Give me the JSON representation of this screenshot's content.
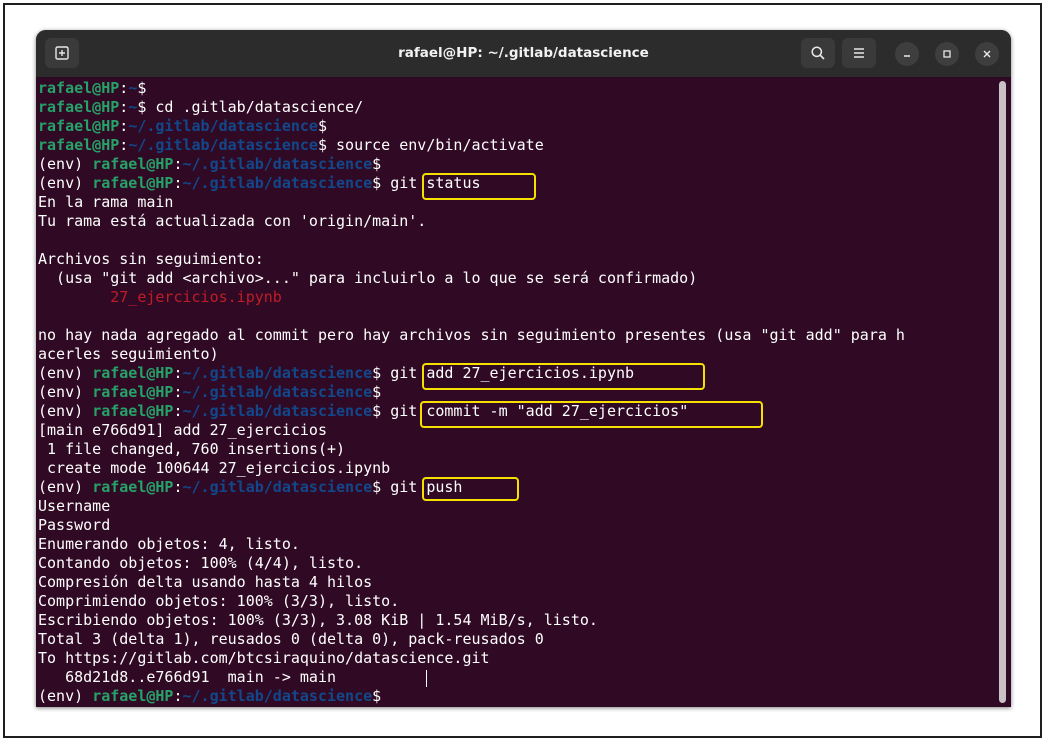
{
  "window": {
    "title": "rafael@HP: ~/.gitlab/datascience"
  },
  "prompt": {
    "user_host": "rafael@HP",
    "sep": ":",
    "env": "(env) ",
    "home": "~",
    "dir": "~/.gitlab/datascience",
    "dollar": "$"
  },
  "commands": {
    "cd": " cd .gitlab/datascience/",
    "source": " source env/bin/activate",
    "status": "git status",
    "add": "git add 27_ejercicios.ipynb",
    "commit": "git commit -m \"add 27_ejercicios\"",
    "push": "git push"
  },
  "output": {
    "status_branch": "En la rama main",
    "status_uptodate": "Tu rama está actualizada con 'origin/main'.",
    "untracked_header": "Archivos sin seguimiento:",
    "untracked_hint": "  (usa \"git add <archivo>...\" para incluirlo a lo que se será confirmado)",
    "untracked_file": "        27_ejercicios.ipynb",
    "nothing_added_1": "no hay nada agregado al commit pero hay archivos sin seguimiento presentes (usa \"git add\" para h",
    "nothing_added_2": "acerles seguimiento)",
    "commit_1": "[main e766d91] add 27_ejercicios",
    "commit_2": " 1 file changed, 760 insertions(+)",
    "commit_3": " create mode 100644 27_ejercicios.ipynb",
    "username": "Username",
    "password": "Password",
    "push_1": "Enumerando objetos: 4, listo.",
    "push_2": "Contando objetos: 100% (4/4), listo.",
    "push_3": "Compresión delta usando hasta 4 hilos",
    "push_4": "Comprimiendo objetos: 100% (3/3), listo.",
    "push_5": "Escribiendo objetos: 100% (3/3), 3.08 KiB | 1.54 MiB/s, listo.",
    "push_6": "Total 3 (delta 1), reusados 0 (delta 0), pack-reusados 0",
    "push_7": "To https://gitlab.com/btcsiraquino/datascience.git",
    "push_8": "   68d21d8..e766d91  main -> main"
  },
  "colors": {
    "background": "#300a24",
    "user": "#26a269",
    "path": "#12488b",
    "untracked": "#c01c28",
    "highlight": "#f5e000"
  }
}
